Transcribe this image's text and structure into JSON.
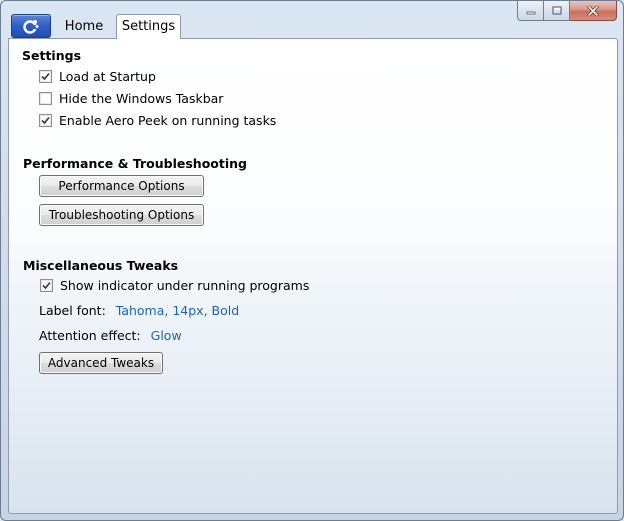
{
  "window": {
    "tabs": [
      {
        "label": "Home"
      },
      {
        "label": "Settings"
      }
    ],
    "app_button_icon": "app-logo-icon",
    "caption_buttons": [
      "minimize-icon",
      "maximize-icon",
      "close-icon"
    ]
  },
  "settings": {
    "heading": "Settings",
    "options": [
      {
        "label": "Load at Startup",
        "checked": true
      },
      {
        "label": "Hide the Windows Taskbar",
        "checked": false
      },
      {
        "label": "Enable Aero Peek on running tasks",
        "checked": true
      }
    ]
  },
  "performance": {
    "heading": "Performance & Troubleshooting",
    "performance_button": "Performance Options",
    "troubleshooting_button": "Troubleshooting Options"
  },
  "misc": {
    "heading": "Miscellaneous Tweaks",
    "show_indicator": {
      "label": "Show indicator under running programs",
      "checked": true
    },
    "label_font": {
      "label": "Label font:",
      "value": "Tahoma, 14px, Bold"
    },
    "attention_effect": {
      "label": "Attention effect:",
      "value": "Glow"
    },
    "advanced_button": "Advanced Tweaks"
  },
  "colors": {
    "link": "#1a66b0",
    "app_button": "#2e5fc2",
    "close_button": "#c8705d"
  }
}
